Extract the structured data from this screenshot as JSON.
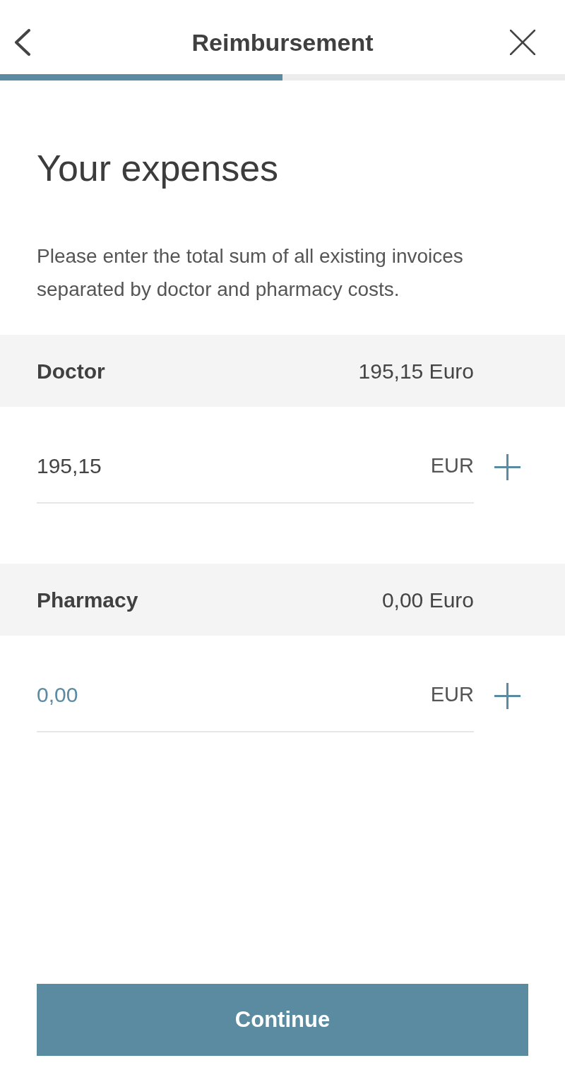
{
  "header": {
    "title": "Reimbursement"
  },
  "progress": {
    "level": 0.5
  },
  "heading": "Your expenses",
  "intro": "Please enter the total sum of all existing invoices separated by doctor and pharmacy costs.",
  "sections": [
    {
      "label": "Doctor",
      "total": "195,15 Euro",
      "input": {
        "value": "195,15",
        "currency": "EUR"
      }
    },
    {
      "label": "Pharmacy",
      "total": "0,00 Euro",
      "input": {
        "placeholder": "0,00",
        "currency": "EUR"
      }
    }
  ],
  "continue_button": "Continue"
}
